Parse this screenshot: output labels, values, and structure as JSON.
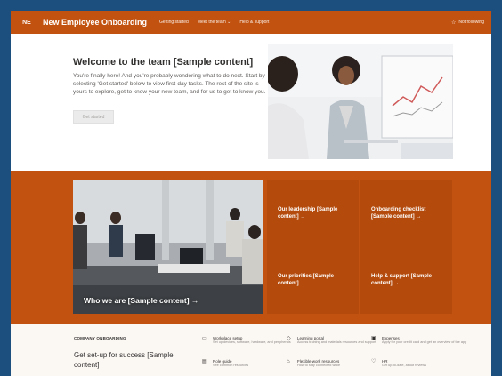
{
  "header": {
    "logo_text": "NE",
    "site_title": "New Employee Onboarding",
    "nav": [
      "Getting started",
      "Meet the team ⌄",
      "Help & support"
    ],
    "follow_label": "Not following"
  },
  "welcome": {
    "title": "Welcome to the team [Sample content]",
    "body": "You're finally here! And you're probably wondering what to do next. Start by selecting 'Get started' below to view first-day tasks. The rest of the site is yours to explore, get to know your new team, and for us to get to know you.",
    "button_label": "Get started"
  },
  "tiles": {
    "main_label": "Who we are [Sample content] →",
    "items": [
      {
        "label": "Our leadership [Sample content] →"
      },
      {
        "label": "Onboarding checklist [Sample content] →"
      },
      {
        "label": "Our priorities [Sample content] →"
      },
      {
        "label": "Help & support [Sample content] →"
      }
    ]
  },
  "setup": {
    "eyebrow": "COMPANY ONBOARDING",
    "title": "Get set-up for success [Sample content]",
    "links": [
      {
        "icon": "laptop-icon",
        "title": "Workplace setup",
        "sub": "Set up devices, software, hardware, and peripherals"
      },
      {
        "icon": "graduation-cap-icon",
        "title": "Learning portal",
        "sub": "Access training and materials resources and support"
      },
      {
        "icon": "card-icon",
        "title": "Expenses",
        "sub": "Apply for your credit card and get an overview of the app"
      },
      {
        "icon": "book-icon",
        "title": "Role guide",
        "sub": "See common resources"
      },
      {
        "icon": "people-icon",
        "title": "Flexible work resources",
        "sub": "How to stay connected while"
      },
      {
        "icon": "heart-icon",
        "title": "HR",
        "sub": "Get up-to-date, about reviews"
      }
    ]
  },
  "colors": {
    "brand": "#c2520f",
    "tile": "#b44a0b",
    "backdrop": "#1c4f7d"
  }
}
